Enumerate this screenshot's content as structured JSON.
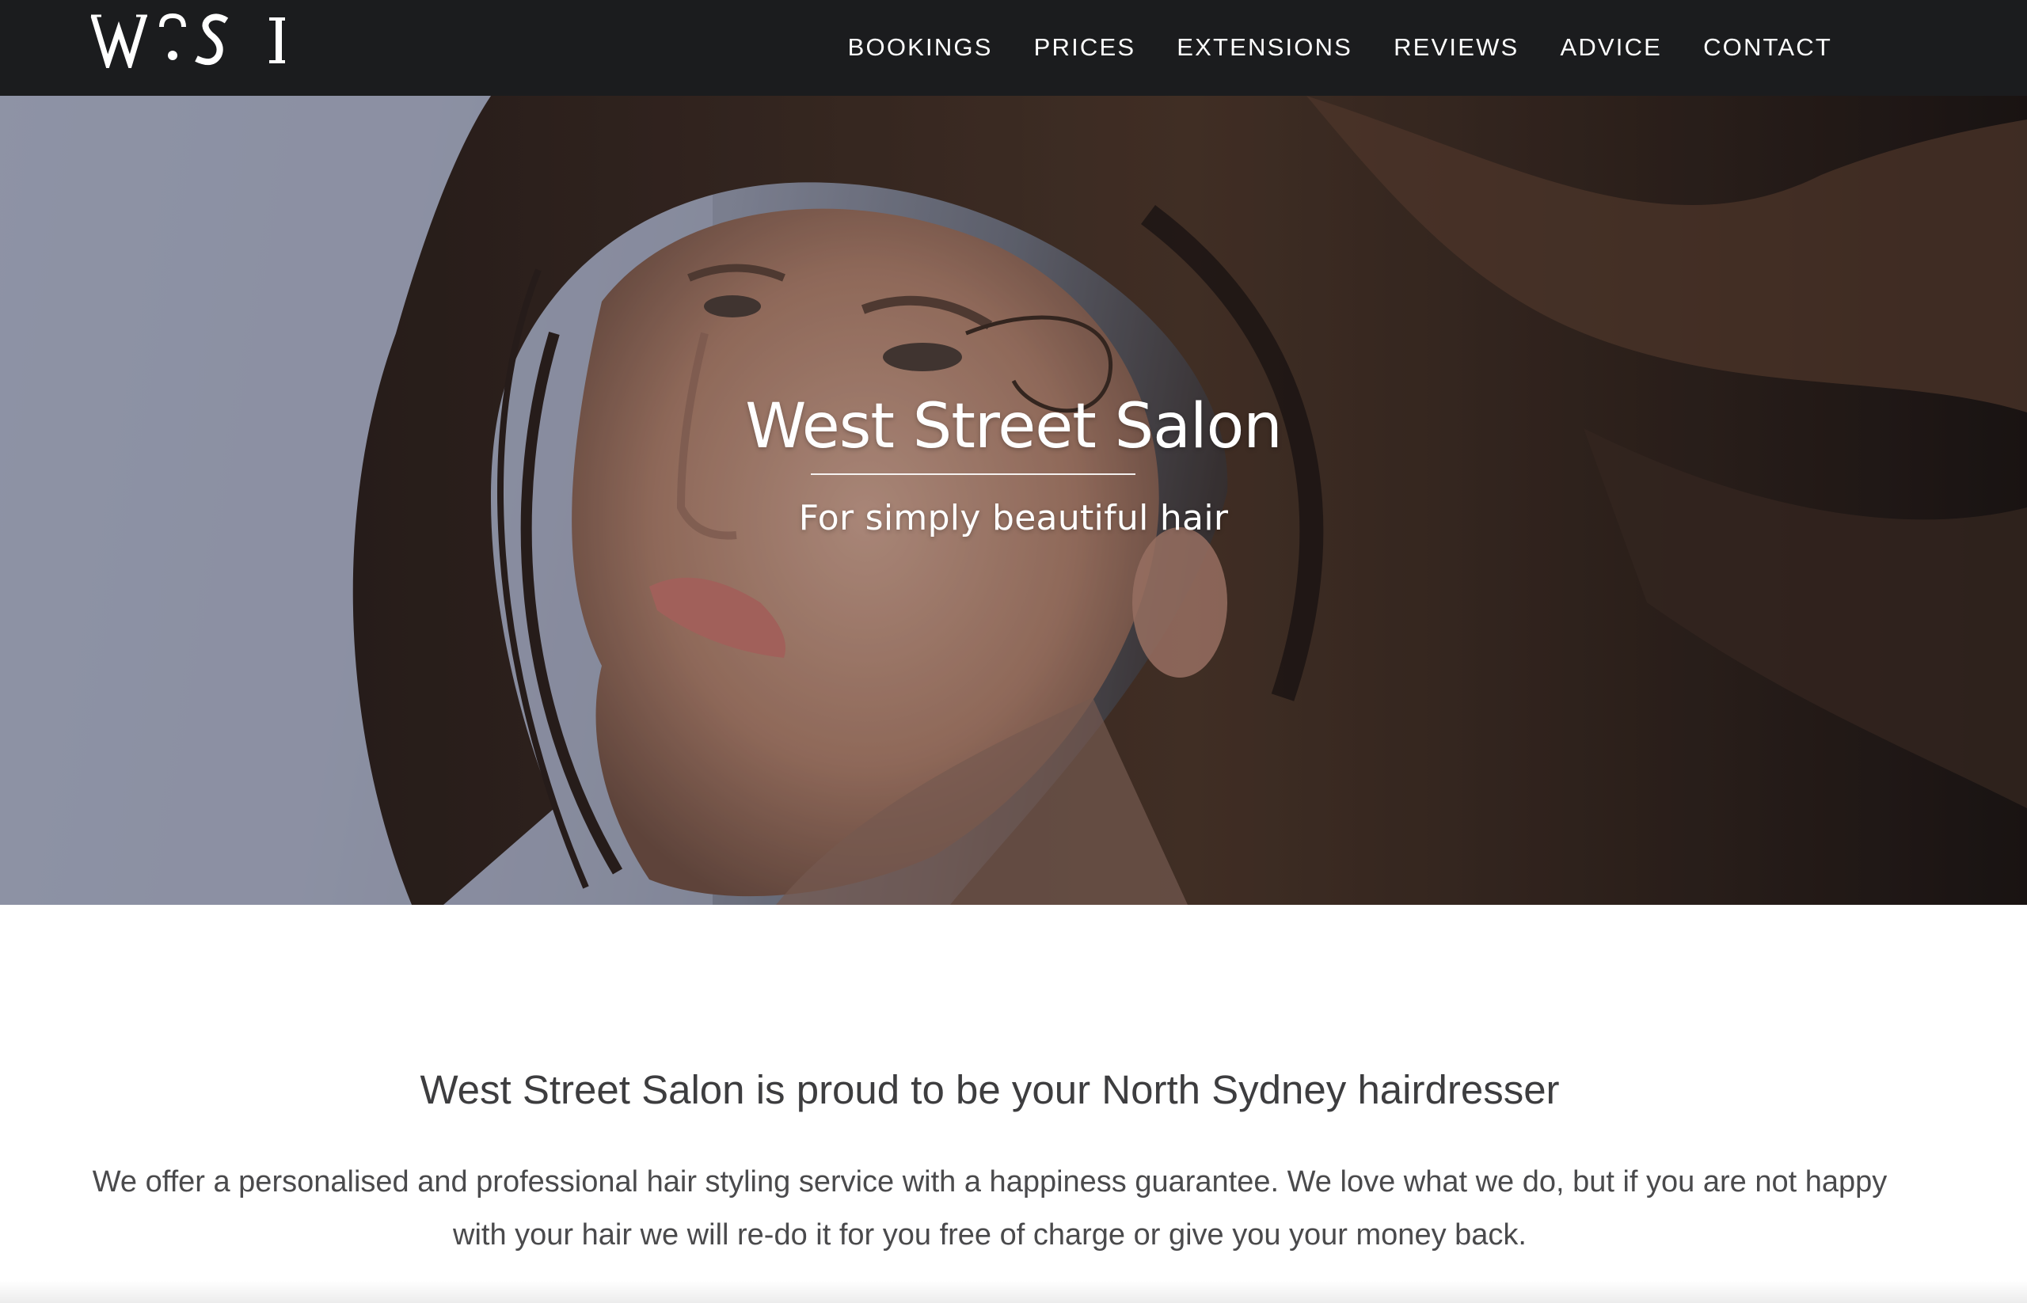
{
  "header": {
    "logo_text": "W?S I",
    "nav": [
      {
        "label": "BOOKINGS"
      },
      {
        "label": "PRICES"
      },
      {
        "label": "EXTENSIONS"
      },
      {
        "label": "REVIEWS"
      },
      {
        "label": "ADVICE"
      },
      {
        "label": "CONTACT"
      }
    ]
  },
  "hero": {
    "title": "West Street Salon",
    "subtitle": "For simply beautiful hair",
    "image_icon": "hero-portrait-image"
  },
  "intro": {
    "heading": "West Street Salon is proud to be your North Sydney hairdresser",
    "body": "We offer a personalised and professional hair styling service with a happiness guarantee. We love what we do, but if you are not happy with your hair we will re-do it for you free of charge or give you your money back."
  },
  "colors": {
    "header_bg": "#1b1c1e",
    "text_dark": "#3d3d3f",
    "hero_sky": "#aab1c6",
    "hair_brown": "#3a2a22"
  }
}
